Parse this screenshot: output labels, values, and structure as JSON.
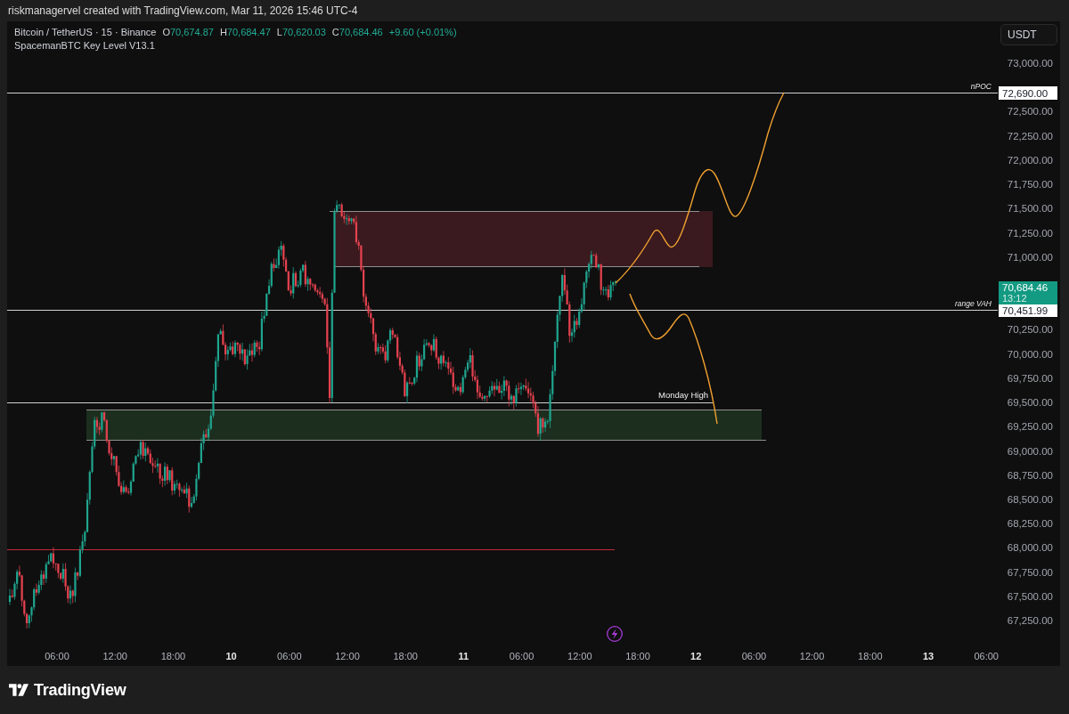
{
  "header": {
    "caption": "riskmanagervel created with TradingView.com, Mar 11, 2026 15:46 UTC-4"
  },
  "legend": {
    "symbol": "Bitcoin / TetherUS · 15 · Binance",
    "rising": true,
    "ohlc": [
      {
        "key": "O",
        "value": "70,674.87"
      },
      {
        "key": "H",
        "value": "70,684.47"
      },
      {
        "key": "L",
        "value": "70,620.03"
      },
      {
        "key": "C",
        "value": "70,684.46"
      }
    ],
    "change": "+9.60 (+0.01%)",
    "indicator": "SpacemanBTC Key Level V13.1"
  },
  "currency_button": {
    "label": "USDT"
  },
  "price_axis": {
    "ticks": [
      "73,000.00",
      "72,500.00",
      "72,250.00",
      "72,000.00",
      "71,750.00",
      "71,500.00",
      "71,250.00",
      "71,000.00",
      "70,250.00",
      "70,000.00",
      "69,750.00",
      "69,500.00",
      "69,250.00",
      "69,000.00",
      "68,750.00",
      "68,500.00",
      "68,250.00",
      "68,000.00",
      "67,750.00",
      "67,500.00",
      "67,250.00"
    ]
  },
  "levels": [
    {
      "label": "nPOC",
      "price": "72,690.00"
    },
    {
      "label": "range VAH",
      "price": "70,451.99"
    },
    {
      "label": "Monday High"
    }
  ],
  "current_price": {
    "price": "70,684.46",
    "countdown": "13:12"
  },
  "time_axis": {
    "ticks": [
      {
        "label": "06:00",
        "kind": "hour"
      },
      {
        "label": "12:00",
        "kind": "hour"
      },
      {
        "label": "18:00",
        "kind": "hour"
      },
      {
        "label": "10",
        "kind": "day"
      },
      {
        "label": "06:00",
        "kind": "hour"
      },
      {
        "label": "12:00",
        "kind": "hour"
      },
      {
        "label": "18:00",
        "kind": "hour"
      },
      {
        "label": "11",
        "kind": "day"
      },
      {
        "label": "06:00",
        "kind": "hour"
      },
      {
        "label": "12:00",
        "kind": "hour"
      },
      {
        "label": "18:00",
        "kind": "hour"
      },
      {
        "label": "12",
        "kind": "day"
      },
      {
        "label": "06:00",
        "kind": "hour"
      },
      {
        "label": "12:00",
        "kind": "hour"
      },
      {
        "label": "18:00",
        "kind": "hour"
      },
      {
        "label": "13",
        "kind": "day"
      },
      {
        "label": "06:00",
        "kind": "hour"
      }
    ]
  },
  "footer": {
    "brand": "TradingView"
  }
}
